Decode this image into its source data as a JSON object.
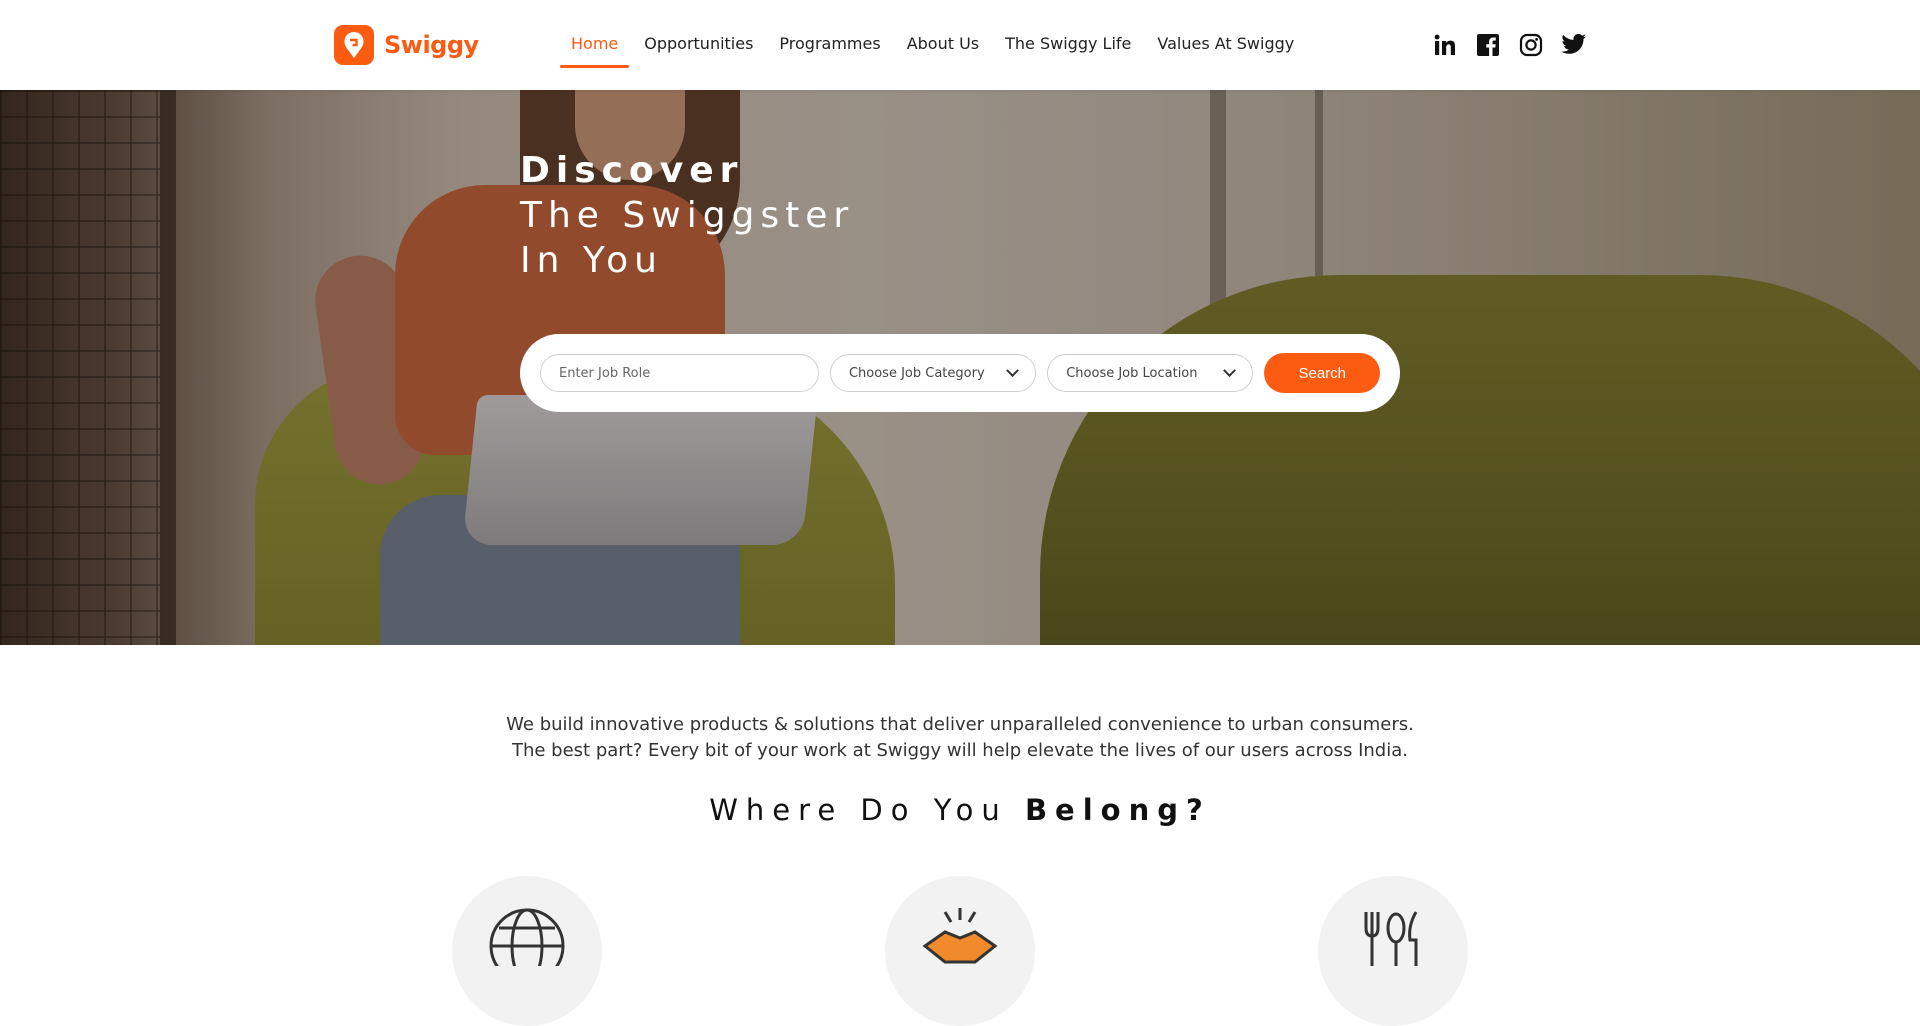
{
  "brand": {
    "name": "Swiggy",
    "accent_color": "#fc5b12"
  },
  "nav": {
    "items": [
      {
        "label": "Home",
        "active": true
      },
      {
        "label": "Opportunities",
        "active": false
      },
      {
        "label": "Programmes",
        "active": false
      },
      {
        "label": "About Us",
        "active": false
      },
      {
        "label": "The Swiggy Life",
        "active": false
      },
      {
        "label": "Values At Swiggy",
        "active": false
      }
    ]
  },
  "social": [
    "linkedin-icon",
    "facebook-icon",
    "instagram-icon",
    "twitter-icon"
  ],
  "hero": {
    "line1": "Discover",
    "line2": "The Swiggster",
    "line3": "In You"
  },
  "search": {
    "job_role_placeholder": "Enter Job Role",
    "category_value": "Choose Job Category",
    "location_value": "Choose Job Location",
    "button_label": "Search"
  },
  "intro": {
    "line1": "We build innovative products & solutions that deliver unparalleled convenience to urban consumers.",
    "line2": "The best part? Every bit of your work at Swiggy will help elevate the lives of our users across India."
  },
  "belong": {
    "prefix": "Where Do You ",
    "bold": "Belong?"
  },
  "categories": [
    "globe-icon",
    "handshake-icon",
    "cutlery-icon"
  ]
}
